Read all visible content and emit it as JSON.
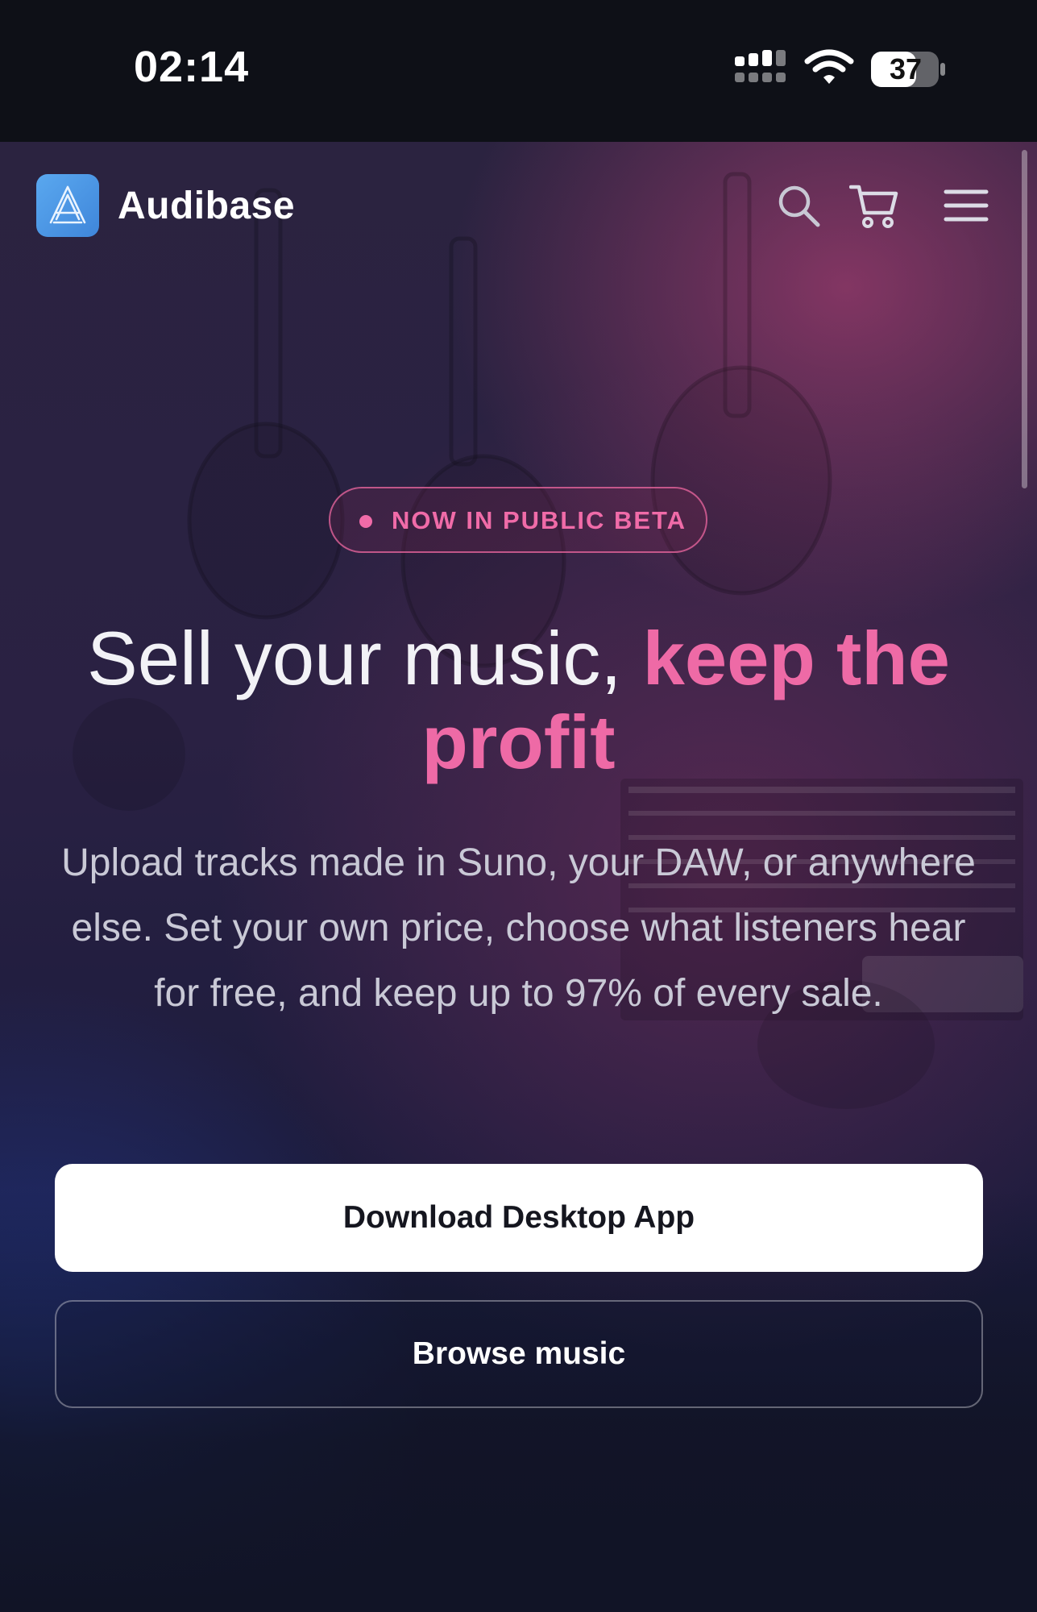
{
  "status_bar": {
    "time": "02:14",
    "battery": "37",
    "icons": [
      "signal-icon",
      "wifi-icon",
      "battery-icon"
    ]
  },
  "nav": {
    "brand": "Audibase",
    "icons": [
      "logo-icon",
      "search-icon",
      "cart-icon",
      "menu-icon"
    ]
  },
  "hero": {
    "badge": "NOW IN PUBLIC BETA",
    "headline_plain": "Sell your music, ",
    "headline_accent": "keep the profit",
    "subtext": "Upload tracks made in Suno, your DAW, or anywhere else. Set your own price, choose what listeners hear for free, and keep up to 97% of every sale.",
    "primary_cta": "Download Desktop App",
    "secondary_cta": "Browse music"
  },
  "colors": {
    "accent_pink": "#ee6aa6",
    "logo_blue": "#4a94e2",
    "background": "#111426"
  }
}
